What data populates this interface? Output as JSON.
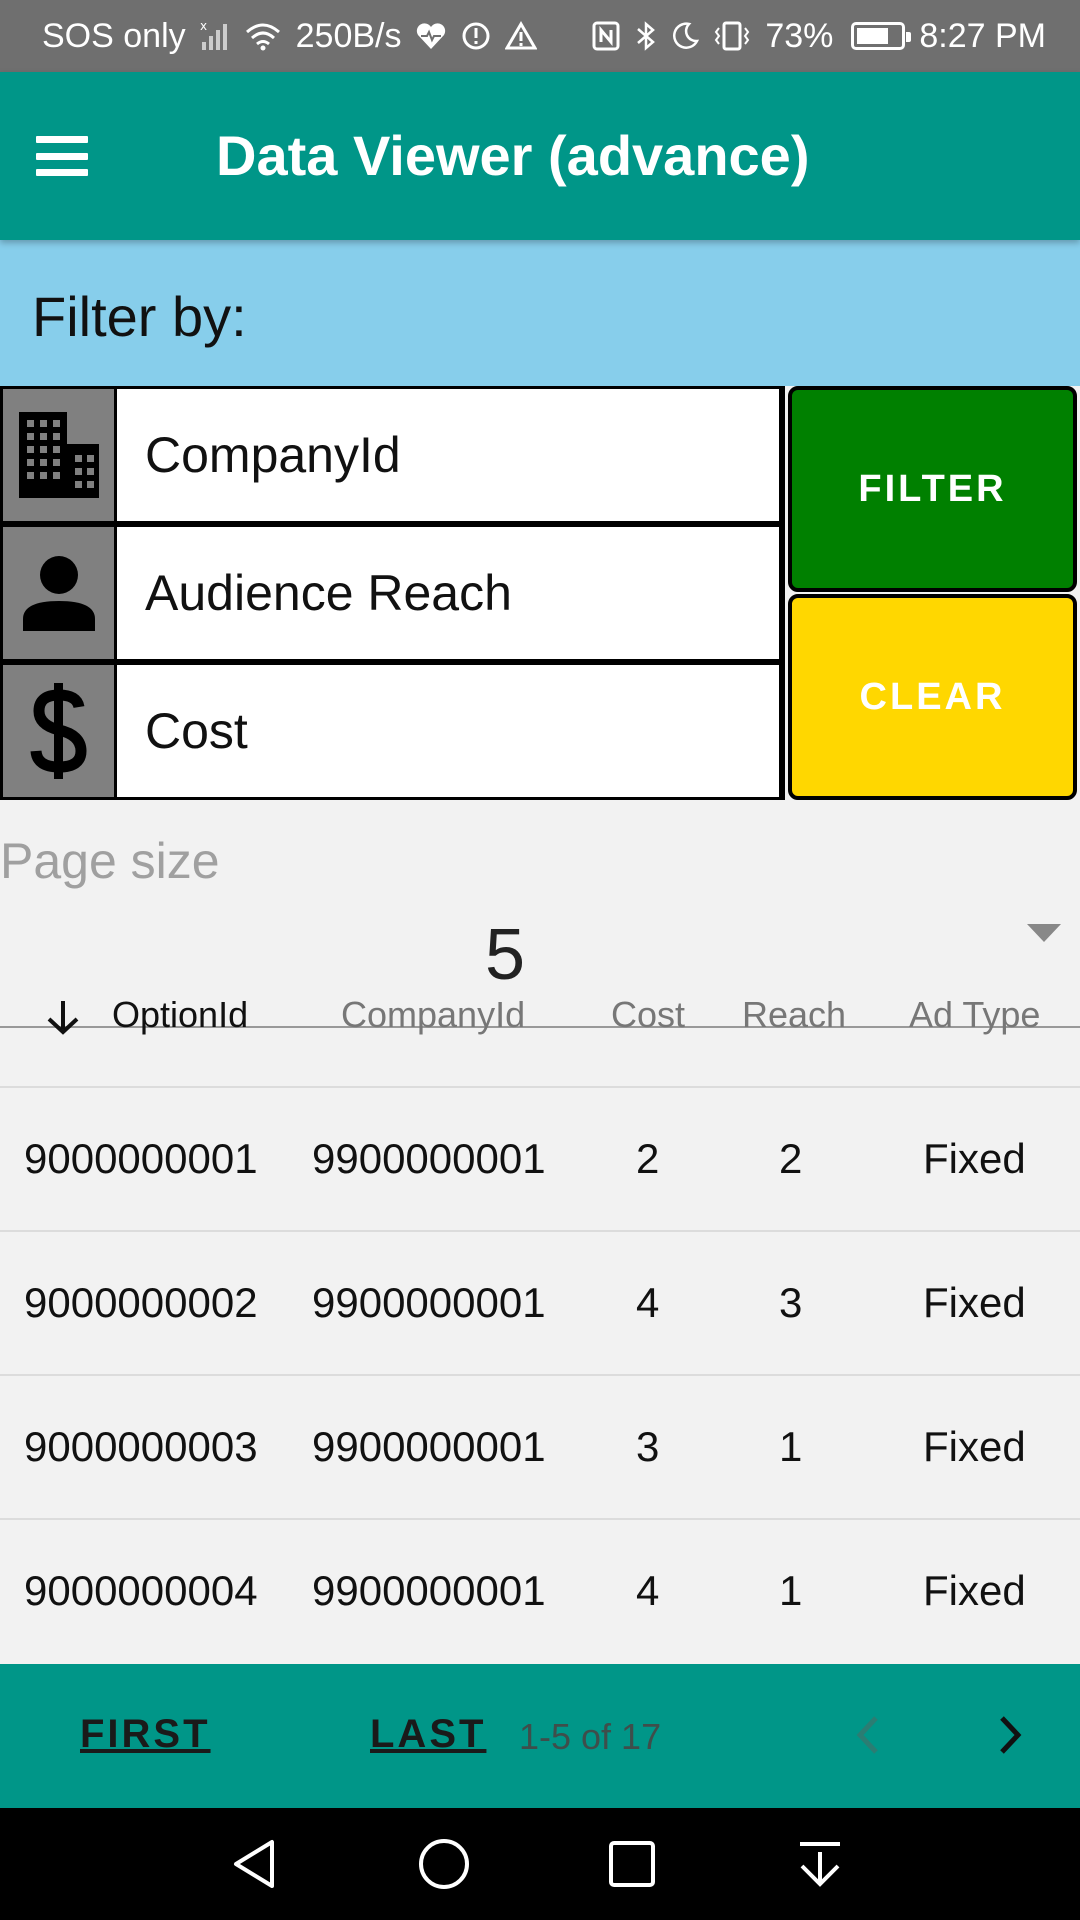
{
  "status_bar": {
    "carrier": "SOS only",
    "speed": "250B/s",
    "battery": "73%",
    "battery_level": 0.73,
    "time": "8:27 PM"
  },
  "app_bar": {
    "title": "Data Viewer (advance)",
    "menu_icon": "menu-icon"
  },
  "filter": {
    "label": "Filter by:",
    "fields": [
      {
        "icon": "building-icon",
        "value": "CompanyId"
      },
      {
        "icon": "person-icon",
        "value": "Audience Reach"
      },
      {
        "icon": "dollar-icon",
        "value": "Cost"
      }
    ],
    "filter_button": "FILTER",
    "clear_button": "CLEAR",
    "colors": {
      "header_bg": "#87ceeb",
      "filter_bg": "#008000",
      "clear_bg": "#ffd700"
    }
  },
  "page_size": {
    "label": "Page size",
    "value": "5"
  },
  "table": {
    "sort_icon": "arrow-down-icon",
    "columns": [
      "OptionId",
      "CompanyId",
      "Cost",
      "Reach",
      "Ad Type"
    ],
    "rows": [
      [
        "9000000001",
        "9900000001",
        "2",
        "2",
        "Fixed"
      ],
      [
        "9000000002",
        "9900000001",
        "4",
        "3",
        "Fixed"
      ],
      [
        "9000000003",
        "9900000001",
        "3",
        "1",
        "Fixed"
      ],
      [
        "9000000004",
        "9900000001",
        "4",
        "1",
        "Fixed"
      ]
    ]
  },
  "pagination": {
    "first": "FIRST",
    "last": "LAST",
    "info": "1-5 of 17",
    "prev_icon": "chevron-left-icon",
    "next_icon": "chevron-right-icon"
  },
  "nav_bar": {
    "buttons": [
      "back-icon",
      "home-icon",
      "recents-icon",
      "notifications-pull-icon"
    ]
  },
  "theme": {
    "primary": "#009688",
    "status_bar": "#6f6f6f"
  }
}
